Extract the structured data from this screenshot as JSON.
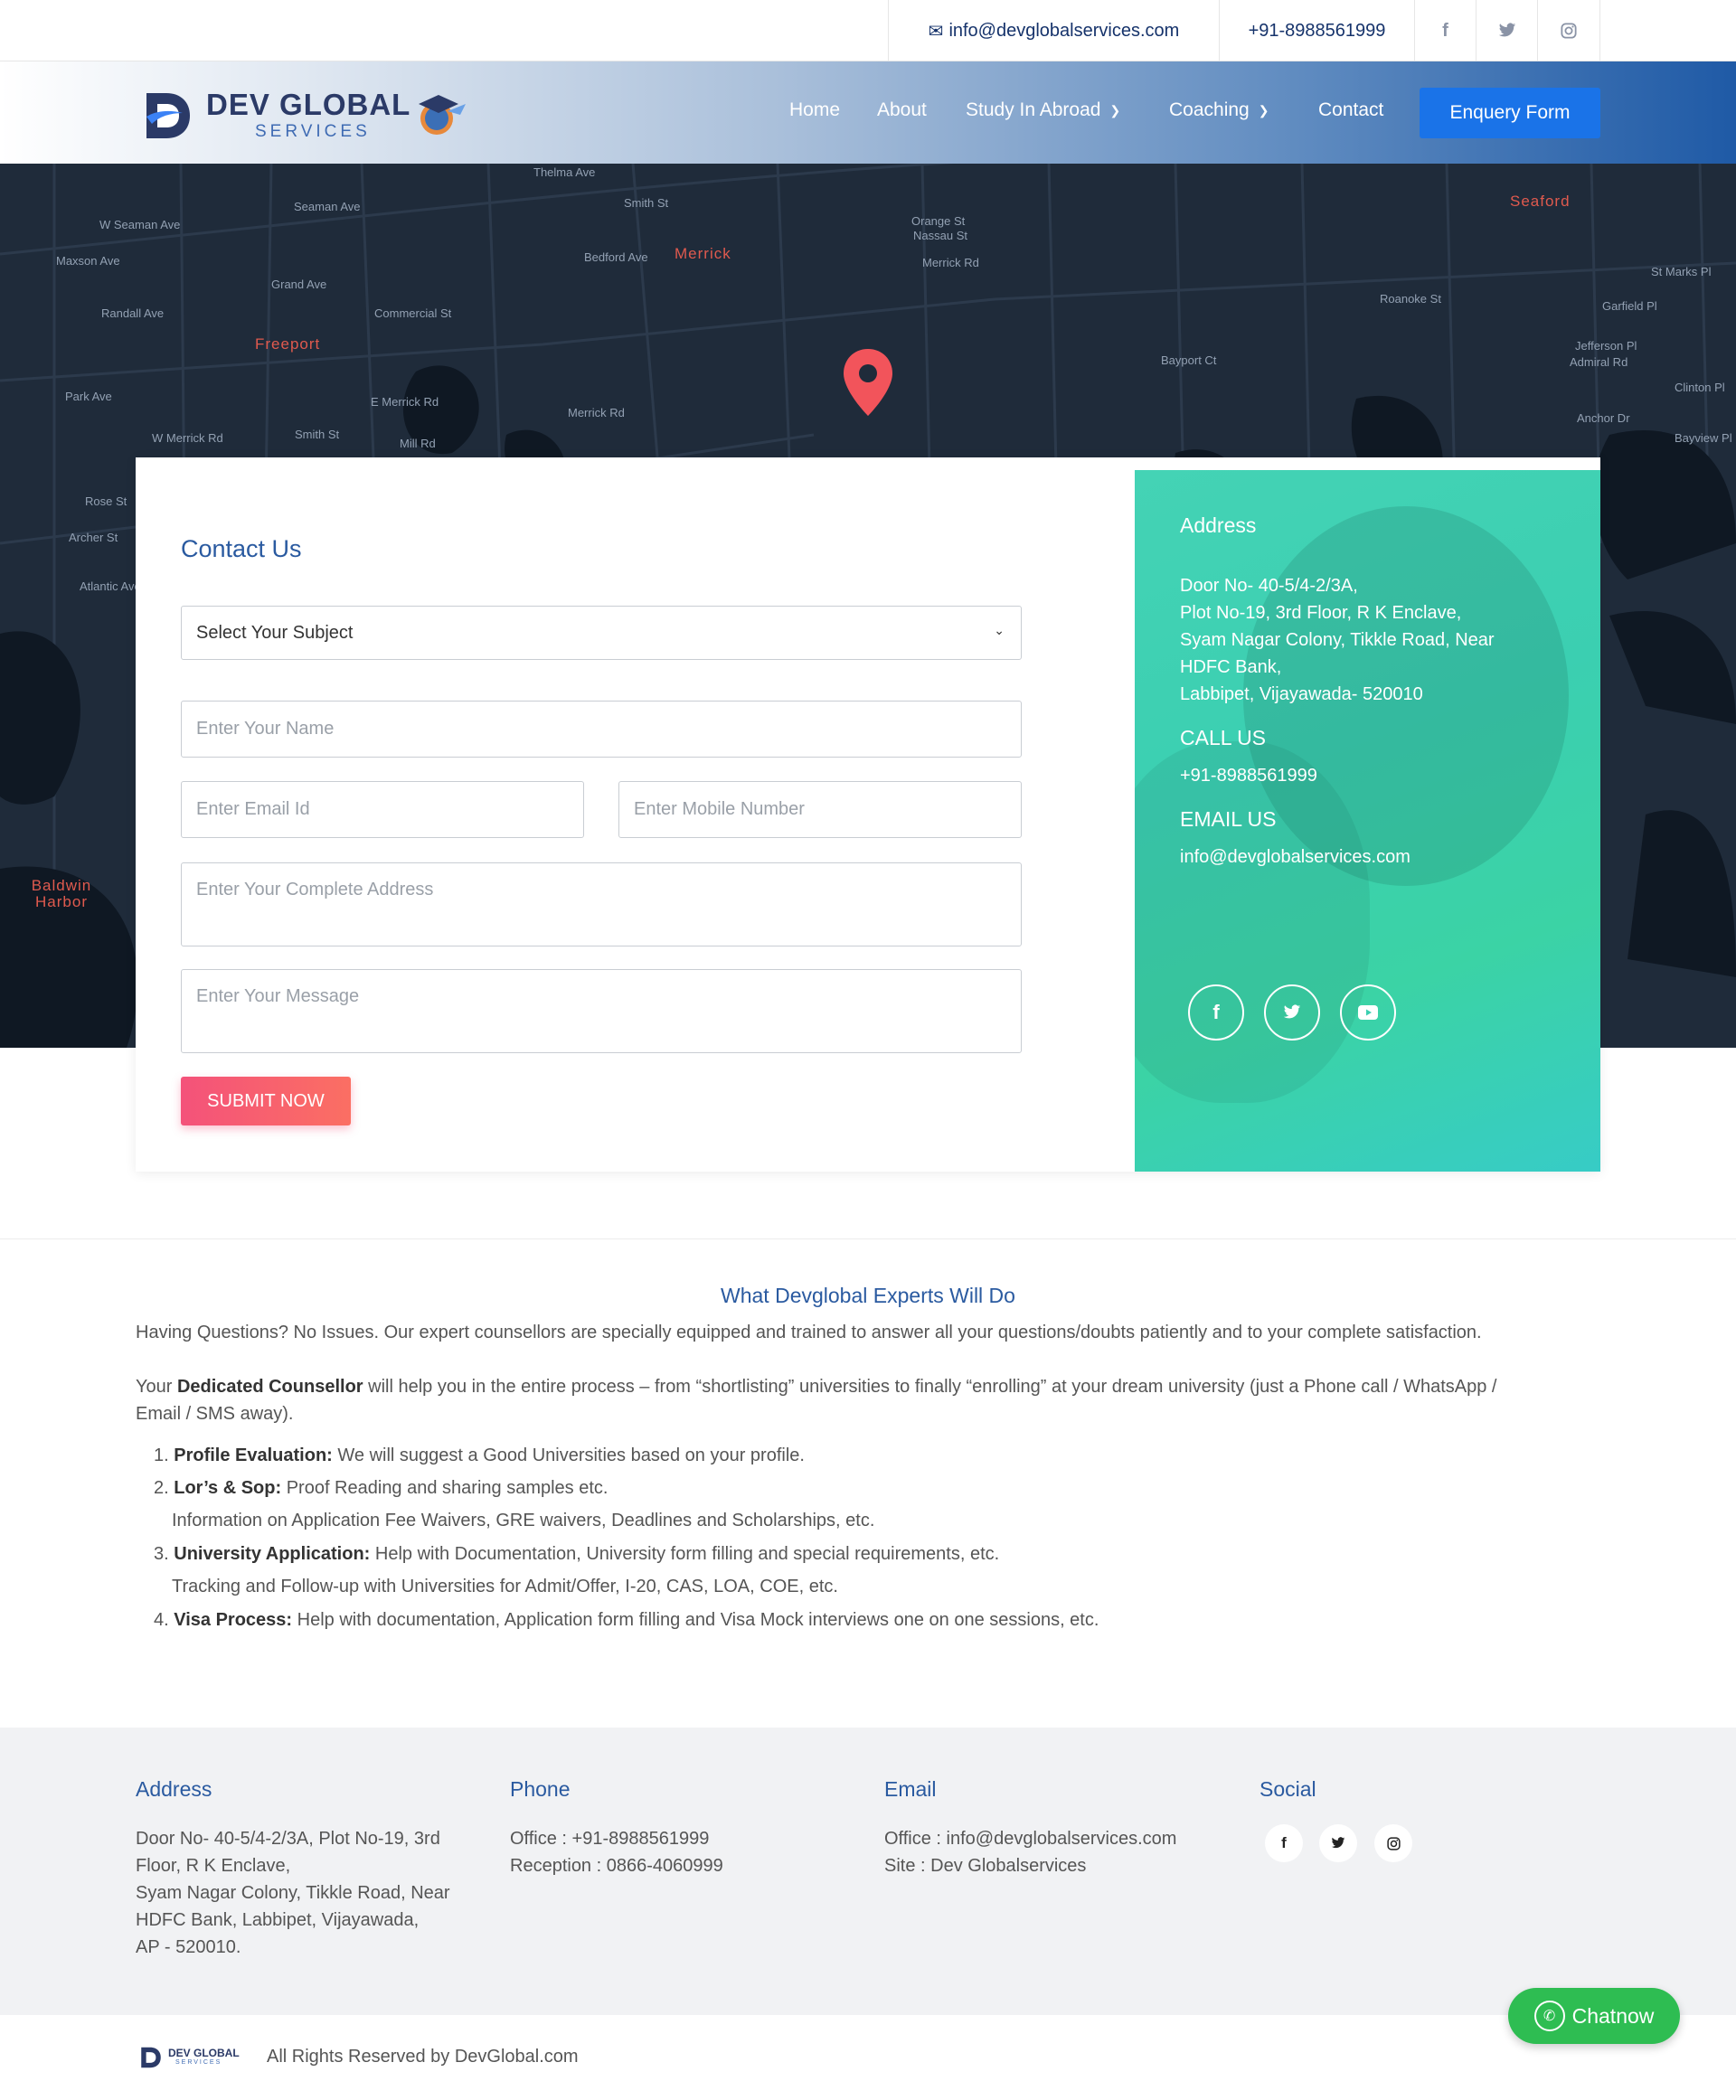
{
  "topbar": {
    "email": "info@devglobalservices.com",
    "phone": "+91-8988561999",
    "icons": [
      "facebook-icon",
      "twitter-icon",
      "instagram-icon"
    ]
  },
  "brand": {
    "name": "DEV GLOBAL",
    "sub": "SERVICES"
  },
  "nav": {
    "home": "Home",
    "about": "About",
    "study": "Study In Abroad",
    "coaching": "Coaching",
    "contact": "Contact",
    "enquiry": "Enquery Form"
  },
  "map": {
    "labels": [
      "Seaman Ave",
      "W Seaman Ave",
      "Maxson Ave",
      "Randall Ave",
      "Freeport",
      "Merrick",
      "Seaford",
      "Baldwin Harbor",
      "Smith St",
      "Bedford Ave",
      "Merrick Rd",
      "Commercial St",
      "Grand Ave",
      "E Merrick Rd",
      "W Merrick Rd",
      "Mill Rd",
      "Smith St",
      "Rose St",
      "Archer St",
      "Atlantic Ave",
      "Park Ave",
      "Merrick Rd",
      "Orange St",
      "Nassau St",
      "Bayport Ct",
      "Roanoke St",
      "Garfield Pl",
      "Jefferson Pl",
      "Admiral Rd",
      "Clinton Pl",
      "Anchor Dr",
      "Bayview Pl",
      "St Marks Pl",
      "Thelma Ave"
    ]
  },
  "contact_form": {
    "title": "Contact Us",
    "subject": "Select Your Subject",
    "name_ph": "Enter Your Name",
    "email_ph": "Enter Email Id",
    "mobile_ph": "Enter Mobile Number",
    "address_ph": "Enter Your Complete Address",
    "message_ph": "Enter Your Message",
    "submit": "SUBMIT NOW"
  },
  "info": {
    "address_head": "Address",
    "address_lines": [
      "Door No- 40-5/4-2/3A,",
      "Plot No-19, 3rd Floor, R K Enclave,",
      "Syam Nagar Colony, Tikkle Road, Near",
      "HDFC Bank,",
      "Labbipet, Vijayawada- 520010"
    ],
    "call_head": "CALL US",
    "call": "+91-8988561999",
    "email_head": "EMAIL US",
    "email": "info@devglobalservices.com",
    "socials": [
      "facebook-icon",
      "twitter-icon",
      "youtube-icon"
    ]
  },
  "experts": {
    "title": "What Devglobal Experts Will Do",
    "p1": "Having Questions? No Issues. Our expert counsellors are specially equipped and trained to answer all your questions/doubts patiently and to your complete satisfaction.",
    "p2_pre": "Your ",
    "p2_bold": "Dedicated Counsellor",
    "p2_post": " will help you in the entire process – from “shortlisting” universities to finally “enrolling” at your dream university (just a Phone call / WhatsApp / Email / SMS away).",
    "items": [
      {
        "num": "1.",
        "bold": "Profile Evaluation:",
        "text": " We will suggest a Good Universities based on your profile."
      },
      {
        "num": "2.",
        "bold": "Lor’s & Sop:",
        "text": " Proof Reading and sharing samples etc."
      },
      {
        "num": "3.",
        "bold": "University Application:",
        "text": " Help with Documentation, University form filling and special requirements, etc."
      },
      {
        "num": "4.",
        "bold": "Visa Process:",
        "text": " Help with documentation, Application form filling and Visa Mock interviews one on one sessions, etc."
      }
    ],
    "sub2": "Information on Application Fee Waivers, GRE waivers, Deadlines and Scholarships, etc.",
    "sub3": "Tracking and Follow-up with Universities for Admit/Offer, I-20, CAS, LOA, COE, etc."
  },
  "footer": {
    "address_head": "Address",
    "address_lines": [
      "Door No- 40-5/4-2/3A, Plot No-19, 3rd",
      "Floor, R K Enclave,",
      "Syam Nagar Colony, Tikkle Road, Near",
      "HDFC Bank, Labbipet, Vijayawada,",
      "AP - 520010."
    ],
    "phone_head": "Phone",
    "phone_lines": [
      "Office : +91-8988561999",
      "Reception : 0866-4060999"
    ],
    "email_head": "Email",
    "email_lines": [
      "Office : info@devglobalservices.com",
      "Site : Dev Globalservices"
    ],
    "social_head": "Social",
    "copyright": "All Rights Reserved by DevGlobal.com",
    "brand_small": "DEV GLOBAL",
    "brand_small_sub": "SERVICES"
  },
  "chat": {
    "label": "Chatnow"
  },
  "colors": {
    "accent": "#1a73e8",
    "heading": "#2a5aa0",
    "submit": "#f4527a",
    "panel": "#3bcfb1",
    "chat": "#2ebd52"
  }
}
